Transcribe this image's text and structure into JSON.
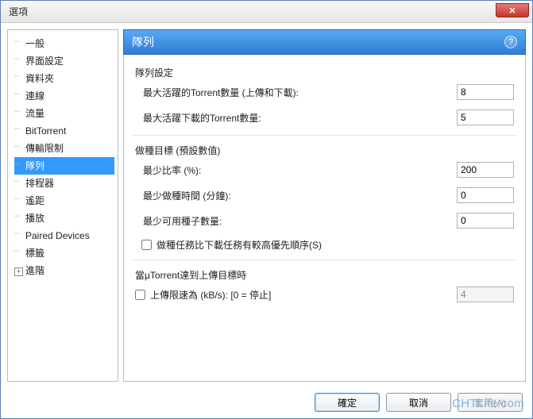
{
  "window": {
    "title": "選項"
  },
  "tree": {
    "items": [
      {
        "label": "一般"
      },
      {
        "label": "界面設定"
      },
      {
        "label": "資料夾"
      },
      {
        "label": "連線"
      },
      {
        "label": "流量"
      },
      {
        "label": "BitTorrent"
      },
      {
        "label": "傳輸限制"
      },
      {
        "label": "隊列",
        "selected": true
      },
      {
        "label": "排程器"
      },
      {
        "label": "遙距"
      },
      {
        "label": "播放"
      },
      {
        "label": "Paired Devices"
      },
      {
        "label": "標籤"
      },
      {
        "label": "進階",
        "expandable": true
      }
    ]
  },
  "panel": {
    "title": "隊列",
    "groups": {
      "queue_settings_title": "隊列設定",
      "max_active_label": "最大活躍的Torrent數量 (上傳和下載):",
      "max_active_value": "8",
      "max_download_label": "最大活躍下載的Torrent數量:",
      "max_download_value": "5",
      "seed_goal_title": "做種目標 (預設數值)",
      "min_ratio_label": "最少比率 (%):",
      "min_ratio_value": "200",
      "min_seed_time_label": "最少做種時間 (分鐘):",
      "min_seed_time_value": "0",
      "min_seeds_label": "最少可用種子數量:",
      "min_seeds_value": "0",
      "seed_priority_label": "做種任務比下載任務有較高優先順序(S)",
      "upload_limit_title": "當µTorrent達到上傳目標時",
      "upload_limit_label": "上傳限速為 (kB/s): [0 = 停止]",
      "upload_limit_value": "4"
    }
  },
  "buttons": {
    "ok": "確定",
    "cancel": "取消",
    "apply": "套用(A)"
  },
  "watermark": "CHTLife.com"
}
